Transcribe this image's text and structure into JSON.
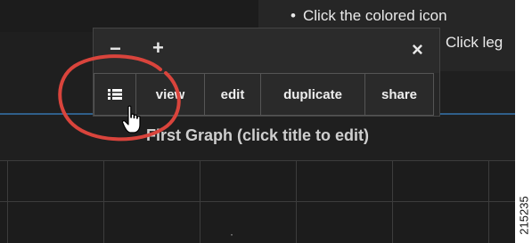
{
  "instructions": [
    {
      "bullet": "•",
      "text": "Click the colored icon"
    },
    {
      "bullet": "•",
      "text": "Click leg"
    }
  ],
  "popup": {
    "minus_icon": "−",
    "plus_icon": "+",
    "close_icon": "×",
    "buttons": {
      "list_icon": "list-icon",
      "view": "view",
      "edit": "edit",
      "duplicate": "duplicate",
      "share": "share"
    }
  },
  "graph": {
    "title": "First Graph (click title to edit)",
    "grid_marker": "·"
  },
  "figure_id": "215235",
  "colors": {
    "background": "#1f1f1f",
    "panel": "#262626",
    "button_border": "#555555",
    "highlight_circle": "#d9443c",
    "divider_line": "#2f5f8a"
  },
  "annotation_icons": [
    "red-highlight-circle",
    "hand-pointer-cursor-icon"
  ]
}
